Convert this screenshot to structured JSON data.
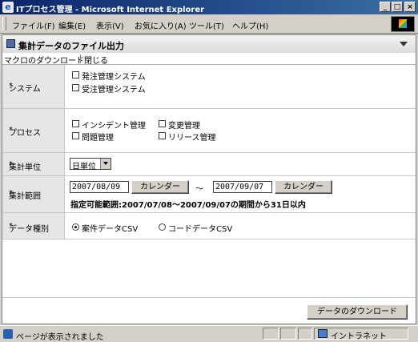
{
  "window": {
    "title": "ITプロセス管理 - Microsoft Internet Explorer",
    "minimize": "_",
    "maximize": "□",
    "close": "×"
  },
  "menu": [
    "ファイル(F)",
    "編集(E)",
    "表示(V)",
    "お気に入り(A)",
    "ツール(T)",
    "ヘルプ(H)"
  ],
  "panel": {
    "title": "集計データのファイル出力",
    "links": [
      "マクロのダウンロード",
      "閉じる"
    ]
  },
  "form": {
    "system": {
      "label": "システム",
      "required": "*",
      "options": [
        "発注管理システム",
        "受注管理システム"
      ]
    },
    "process": {
      "label": "プロセス",
      "required": "*",
      "options": [
        "インシデント管理",
        "変更管理",
        "問題管理",
        "リリース管理"
      ]
    },
    "unit": {
      "label": "集計単位",
      "required": "*",
      "value": "日単位"
    },
    "range": {
      "label": "集計範囲",
      "required": "*",
      "from": "2007/08/09",
      "to": "2007/09/07",
      "calendar": "カレンダー",
      "tilde": "～",
      "note": "指定可能範囲:2007/07/08～2007/09/07の期間から31日以内"
    },
    "datatype": {
      "label": "データ種別",
      "required": "*",
      "options": [
        "案件データCSV",
        "コードデータCSV"
      ],
      "selected": 0
    }
  },
  "download_button": "データのダウンロード",
  "status": {
    "text": "ページが表示されました",
    "zone": "イントラネット"
  }
}
